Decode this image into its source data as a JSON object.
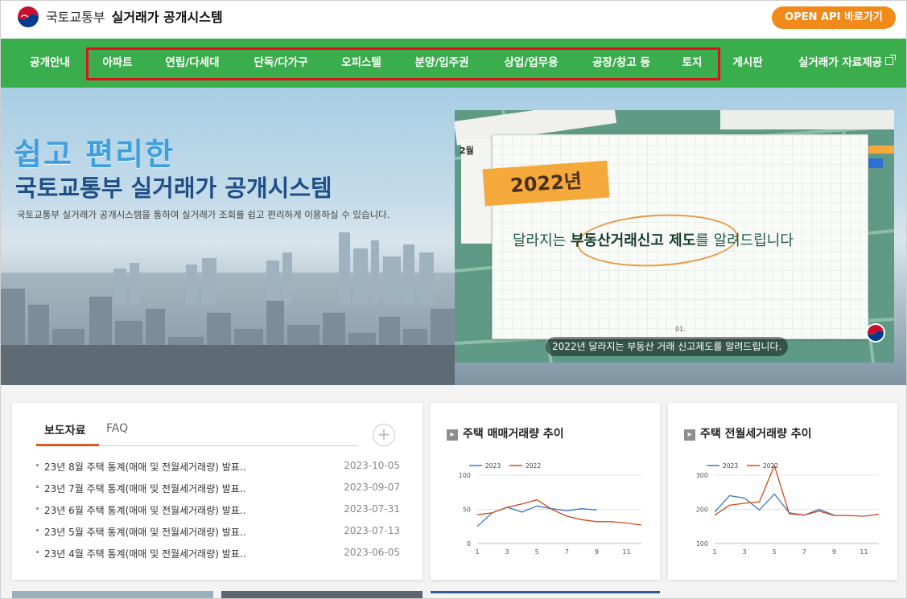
{
  "header": {
    "ministry": "국토교통부",
    "system_title": "실거래가 공개시스템",
    "api_button": "OPEN API 바로가기"
  },
  "nav": {
    "items": [
      {
        "label": "공개안내"
      },
      {
        "label": "아파트"
      },
      {
        "label": "연립/다세대"
      },
      {
        "label": "단독/다가구"
      },
      {
        "label": "오피스텔"
      },
      {
        "label": "분양/입주권"
      },
      {
        "label": "상업/업무용"
      },
      {
        "label": "공장/창고 등"
      },
      {
        "label": "토지"
      },
      {
        "label": "게시판"
      },
      {
        "label": "실거래가 자료제공"
      }
    ]
  },
  "hero": {
    "headline": "쉽고 편리한",
    "title": "국토교통부 실거래가 공개시스템",
    "subtitle": "국토교통부 실거래가 공개시스템을 통하여 실거래가 조회를 쉽고 편리하게 이용하실 수 있습니다.",
    "slide": {
      "month": "2월",
      "year": "2022년",
      "heading_pre": "달라지는 ",
      "heading_bold": "부동산거래신고 제도",
      "heading_post": "를 알려드립니다",
      "page_number": "01.",
      "caption": "2022년 달라지는 부동산 거래 신고제도를 알려드립니다."
    }
  },
  "news": {
    "tabs": [
      "보도자료",
      "FAQ"
    ],
    "more": "+",
    "items": [
      {
        "title": "23년 8월 주택 통계(매매 및 전월세거래량) 발표..",
        "date": "2023-10-05"
      },
      {
        "title": "23년 7월 주택 통계(매매 및 전월세거래량) 발표..",
        "date": "2023-09-07"
      },
      {
        "title": "23년 6월 주택 통계(매매 및 전월세거래량) 발표..",
        "date": "2023-07-31"
      },
      {
        "title": "23년 5월 주택 통계(매매 및 전월세거래량) 발표..",
        "date": "2023-07-13"
      },
      {
        "title": "23년 4월 주택 통계(매매 및 전월세거래량) 발표..",
        "date": "2023-06-05"
      }
    ]
  },
  "colors": {
    "brand_green": "#3aad4c",
    "accent_orange": "#f28a1a",
    "series_2023": "#3a78c7",
    "series_2022": "#d0491c"
  },
  "chart_data": [
    {
      "type": "line",
      "title": "주택 매매거래량 추이",
      "x": [
        1,
        2,
        3,
        4,
        5,
        6,
        7,
        8,
        9,
        10,
        11,
        12
      ],
      "xticks": [
        "1",
        "3",
        "5",
        "7",
        "9",
        "11"
      ],
      "ylim": [
        0,
        100
      ],
      "yticks": [
        "0",
        "50",
        "100"
      ],
      "legend": "top-left",
      "series": [
        {
          "name": "2023",
          "color": "#3a78c7",
          "values": [
            25,
            45,
            53,
            46,
            55,
            51,
            48,
            51,
            49
          ]
        },
        {
          "name": "2022",
          "color": "#d0491c",
          "values": [
            42,
            45,
            53,
            58,
            64,
            50,
            40,
            35,
            32,
            32,
            30,
            27
          ]
        }
      ]
    },
    {
      "type": "line",
      "title": "주택 전월세거래량 추이",
      "x": [
        1,
        2,
        3,
        4,
        5,
        6,
        7,
        8,
        9,
        10,
        11,
        12
      ],
      "xticks": [
        "1",
        "3",
        "5",
        "7",
        "9",
        "11"
      ],
      "ylim": [
        100,
        300
      ],
      "yticks": [
        "100",
        "200",
        "300"
      ],
      "legend": "top-left",
      "series": [
        {
          "name": "2023",
          "color": "#3a78c7",
          "values": [
            192,
            240,
            233,
            198,
            245,
            190,
            183,
            200,
            183
          ]
        },
        {
          "name": "2022",
          "color": "#d0491c",
          "values": [
            183,
            212,
            218,
            222,
            328,
            187,
            183,
            195,
            182,
            182,
            180,
            186
          ]
        }
      ]
    }
  ]
}
